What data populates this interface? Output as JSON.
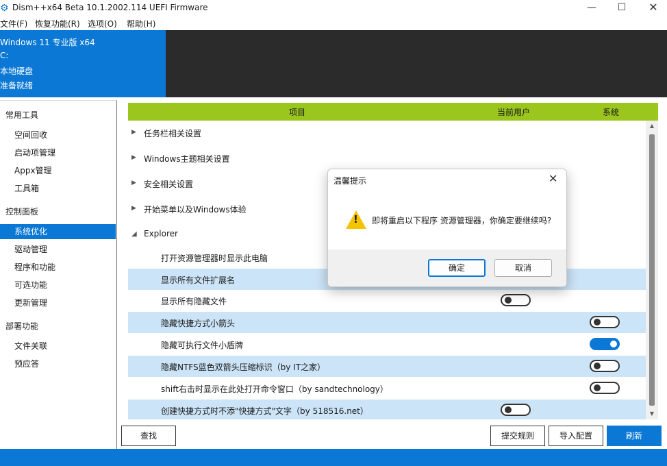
{
  "window": {
    "title": "Dism++x64 Beta 10.1.2002.114 UEFI Firmware",
    "minimize": "—",
    "maximize": "☐",
    "close": "✕"
  },
  "menu": [
    "文件(F)",
    "恢复功能(R)",
    "选项(O)",
    "帮助(H)"
  ],
  "header": {
    "os": "Windows 11 专业版 x64",
    "drive": "C:",
    "disk_type": "本地硬盘",
    "status": "准备就绪"
  },
  "sidebar": {
    "sections": [
      {
        "title": "常用工具",
        "items": [
          "空间回收",
          "启动项管理",
          "Appx管理",
          "工具箱"
        ]
      },
      {
        "title": "控制面板",
        "items": [
          "系统优化",
          "驱动管理",
          "程序和功能",
          "可选功能",
          "更新管理"
        ]
      },
      {
        "title": "部署功能",
        "items": [
          "文件关联",
          "预应答"
        ]
      }
    ],
    "active": "系统优化"
  },
  "table": {
    "columns": [
      "项目",
      "当前用户",
      "系统"
    ],
    "groups": [
      {
        "label": "任务栏相关设置",
        "expanded": false
      },
      {
        "label": "Windows主题相关设置",
        "expanded": false
      },
      {
        "label": "安全相关设置",
        "expanded": false
      },
      {
        "label": "开始菜单以及Windows体验",
        "expanded": false
      },
      {
        "label": "Explorer",
        "expanded": true
      }
    ],
    "options": [
      {
        "label": "打开资源管理器时显示此电脑",
        "highlight": false,
        "user": null,
        "system": null
      },
      {
        "label": "显示所有文件扩展名",
        "highlight": true,
        "user": null,
        "system": null
      },
      {
        "label": "显示所有隐藏文件",
        "highlight": false,
        "user": "off",
        "system": null
      },
      {
        "label": "隐藏快捷方式小箭头",
        "highlight": true,
        "user": null,
        "system": "off"
      },
      {
        "label": "隐藏可执行文件小盾牌",
        "highlight": false,
        "user": null,
        "system": "on"
      },
      {
        "label": "隐藏NTFS蓝色双箭头压缩标识（by IT之家）",
        "highlight": true,
        "user": null,
        "system": "off"
      },
      {
        "label": "shift右击时显示在此处打开命令窗口（by sandtechnology）",
        "highlight": false,
        "user": null,
        "system": "off"
      },
      {
        "label": "创建快捷方式时不添\"快捷方式\"文字（by 518516.net）",
        "highlight": true,
        "user": "off",
        "system": null
      }
    ]
  },
  "buttons": {
    "find": "查找",
    "submit_rule": "提交规则",
    "import_config": "导入配置",
    "refresh": "刷新"
  },
  "dialog": {
    "title": "温馨提示",
    "message": "即将重启以下程序 资源管理器，你确定要继续吗?",
    "ok": "确定",
    "cancel": "取消",
    "close": "✕",
    "icon": "warning-icon"
  },
  "colors": {
    "accent": "#0a78d4",
    "table_header": "#9bc61e",
    "row_highlight": "#cce4f7",
    "header_dark": "#2b2b2b",
    "warning": "#f5c400"
  }
}
